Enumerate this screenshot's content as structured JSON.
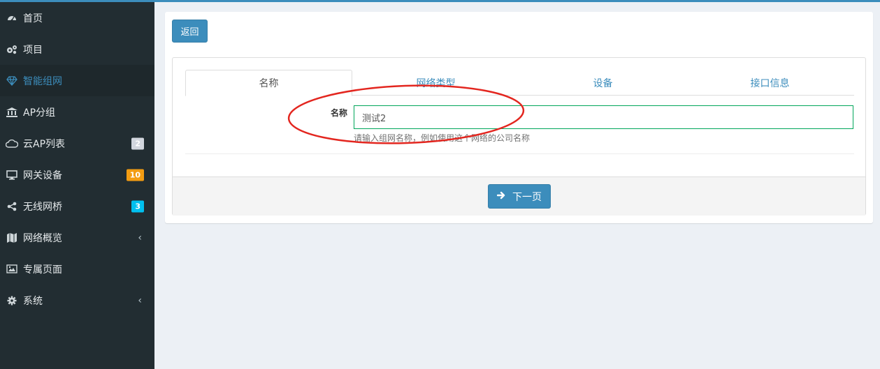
{
  "sidebar": {
    "items": [
      {
        "label": "首页",
        "icon": "dashboard-icon"
      },
      {
        "label": "项目",
        "icon": "gears-icon"
      },
      {
        "label": "智能组网",
        "icon": "diamond-icon",
        "active": true
      },
      {
        "label": "AP分组",
        "icon": "bank-icon"
      },
      {
        "label": "云AP列表",
        "icon": "cloud-icon",
        "badge": "2"
      },
      {
        "label": "网关设备",
        "icon": "desktop-icon",
        "badge": "10"
      },
      {
        "label": "无线网桥",
        "icon": "share-icon",
        "badge": "3"
      },
      {
        "label": "网络概览",
        "icon": "map-icon",
        "chevron": "‹"
      },
      {
        "label": "专属页面",
        "icon": "image-icon"
      },
      {
        "label": "系统",
        "icon": "cog-icon",
        "chevron": "‹"
      }
    ]
  },
  "toolbar": {
    "back_label": "返回"
  },
  "tabs": [
    {
      "label": "名称"
    },
    {
      "label": "网络类型"
    },
    {
      "label": "设备"
    },
    {
      "label": "接口信息"
    }
  ],
  "form": {
    "name_label": "名称",
    "name_value": "测试2",
    "help_text": "请输入组网名称，例如使用这个网络的公司名称"
  },
  "footer": {
    "next_label": "下一页"
  },
  "colors": {
    "accent": "#3c8dbc",
    "sidebar_bg": "#222d32",
    "input_border": "#00a65a",
    "annotation": "#e3261f",
    "badge_orange": "#f39c12",
    "badge_cyan": "#00c0ef",
    "badge_gray": "#d2d6de"
  }
}
